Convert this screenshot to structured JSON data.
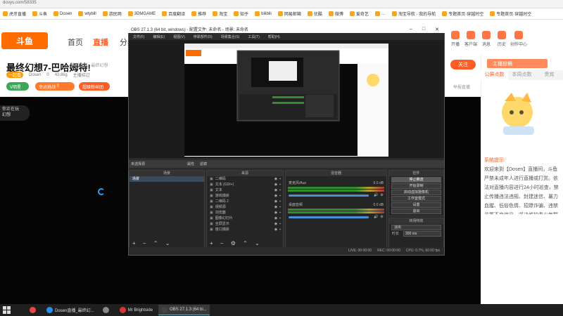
{
  "browser": {
    "url": "douyu.com/58335",
    "bookmarks": [
      "虎牙直播",
      "斗鱼",
      "Dosen",
      "wtybill",
      "游民网",
      "3DMGAME",
      "百度翻译",
      "推荐",
      "淘宝",
      "知乎",
      "bilibili",
      "网易邮箱",
      "优酷",
      "微博",
      "爱奇艺",
      "…",
      "淘宝导航 - 我的导航",
      "专题首页·穿越时空",
      "专题首页·穿越时空"
    ]
  },
  "site": {
    "logo_text": "斗鱼",
    "nav": [
      "首页",
      "直播",
      "分类"
    ],
    "header_icons": [
      "开播",
      "客户端",
      "消息",
      "历史",
      "创作中心"
    ]
  },
  "room": {
    "title": "最终幻想7-巴哈姆特!",
    "tag": "一起看",
    "streamer": "Dosen",
    "likes": "0",
    "heat": "43.8kg",
    "host_label": "主播招过",
    "category_1": "单机热游",
    "category_2": "最终幻想",
    "level_badge": "V明星",
    "challenge_btn": "幸运挑战",
    "challenge_count": "0",
    "fanclub_btn": "超级粉丝团",
    "follow_btn": "关注",
    "report_link": "举报直播"
  },
  "video": {
    "float_card_line1": "你正在玩",
    "float_card_line2": "幻想"
  },
  "right_panel": {
    "anchor_btn": "主播投稿",
    "tabs": [
      "公屏点数",
      "本周点数",
      "贵宾"
    ],
    "sys_prefix": "系统提示:",
    "sys_msg": "欢迎来到【Dosen】直播间，斗鱼严禁未成年人进行直播或打赏。依法对直播内容进行24小时巡查，禁止传播违法违规、封建迷信、暴力血腥、低俗色情、招嫖诈骗、违禁品等不良信息，坚决维护青少年群体精神文明健康。请勿轻信各类招聘征婚、代练代抽、刷钻、购买礼包码、游戏币等广告信息，且如主播在推广商品中诱导私下交易，请谨慎判断，以防人身财产损失。请大家注意财产安全，谨防网络诈骗。"
  },
  "obs": {
    "title": "OBS 27.1.3 (64 bit, windows) - 配置文件: 未命名 - 场景: 未命名",
    "menu": [
      "文件(F)",
      "编辑(E)",
      "视图(V)",
      "停靠部件(D)",
      "场景集合(S)",
      "工具(T)",
      "帮助(H)"
    ],
    "source_bar": [
      "未选择源",
      "属性",
      "滤镜"
    ],
    "scenes_header": "场景",
    "scenes": [
      "场景"
    ],
    "sources_header": "来源",
    "sources": [
      "二维码",
      "文本 (GDI+)",
      "文本",
      "游戏捕获",
      "二维码 2",
      "视频源",
      "浏览器",
      "图像幻灯片",
      "全屏显示",
      "窗口捕获"
    ],
    "mixer_header": "混音器",
    "mixer": [
      {
        "name": "麦克风/Aux",
        "db": "0.0 dB"
      },
      {
        "name": "桌面音频",
        "db": "0.0 dB"
      }
    ],
    "controls_header": "控件",
    "controls": [
      "停止推流",
      "开始录制",
      "启动虚拟摄像机",
      "工作室模式",
      "设置",
      "退出"
    ],
    "transition_header": "转场特效",
    "transition_value": "淡出",
    "duration_label": "时长",
    "duration_value": "300 ms",
    "status": [
      "LIVE: 00:00:00",
      "REC: 00:00:00",
      "CPU: 0.7%, 60.00 fps"
    ]
  },
  "taskbar": [
    {
      "label": "",
      "color": "#e44"
    },
    {
      "label": "Dosen直播_最终幻...",
      "color": "#2a8df4"
    },
    {
      "label": "",
      "color": "#888"
    },
    {
      "label": "Mr Brightside",
      "color": "#d33"
    },
    {
      "label": "OBS 27.1.3 (64 bi...",
      "color": "#444"
    }
  ]
}
